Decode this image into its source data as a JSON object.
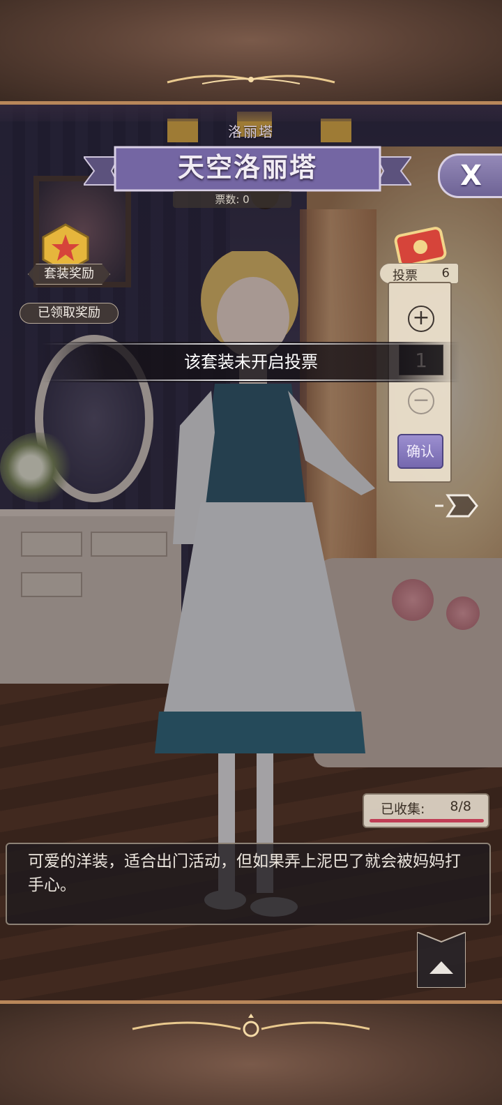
{
  "suit": {
    "category": "洛丽塔",
    "title": "天空洛丽塔",
    "votes_label": "票数: 0"
  },
  "rewards": {
    "set_reward_label": "套装奖励",
    "claimed_label": "已领取奖励"
  },
  "vote_panel": {
    "label": "投票",
    "available": "6",
    "quantity": "1",
    "plus": "+",
    "minus": "−",
    "confirm_label": "确认"
  },
  "toast": {
    "message": "该套装未开启投票"
  },
  "collection": {
    "label": "已收集:",
    "value": "8/8",
    "progress": 1.0
  },
  "description": "可爱的洋装，适合出门活动，但如果弄上泥巴了就会被妈妈打手心。",
  "close": {
    "label": "X"
  },
  "colors": {
    "banner": "#6e6395",
    "accent_gold": "#b8875a",
    "progress": "#c03d55"
  },
  "icons": [
    "star-badge-icon",
    "ticket-icon",
    "close-icon",
    "side-arrow-icon",
    "collapse-arrow-icon"
  ]
}
